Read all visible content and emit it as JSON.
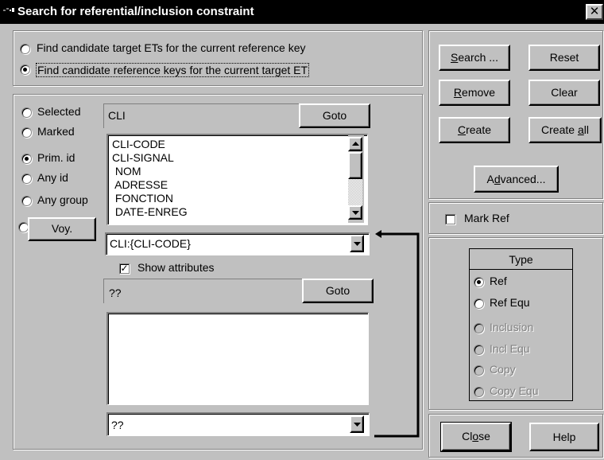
{
  "window": {
    "title": "Search for referential/inclusion constraint",
    "close_label": "✕"
  },
  "mode": {
    "options": [
      {
        "label": "Find candidate target ETs for the current reference key",
        "selected": false
      },
      {
        "label": "Find candidate reference keys for the current target ET",
        "selected": true
      }
    ]
  },
  "scope": {
    "options": [
      {
        "label": "Selected",
        "selected": false
      },
      {
        "label": "Marked",
        "selected": false
      },
      {
        "label": "Prim. id",
        "selected": true
      },
      {
        "label": "Any id",
        "selected": false
      },
      {
        "label": "Any group",
        "selected": false
      }
    ],
    "voy_label": "Voy."
  },
  "upper": {
    "field_value": "CLI",
    "goto_label": "Goto",
    "list_items": [
      "CLI-CODE",
      "CLI-SIGNAL",
      " NOM",
      " ADRESSE",
      " FONCTION",
      " DATE-ENREG"
    ],
    "combo_value": "CLI:{CLI-CODE}",
    "show_attributes_label": "Show attributes",
    "show_attributes_checked": true
  },
  "lower": {
    "field_value": "??",
    "goto_label": "Goto",
    "list_items": [],
    "combo_value": "??"
  },
  "buttons": {
    "search": {
      "pre": "",
      "key": "S",
      "post": "earch ..."
    },
    "reset": "Reset",
    "remove": {
      "pre": "",
      "key": "R",
      "post": "emove"
    },
    "clear": "Clear",
    "create": {
      "pre": "",
      "key": "C",
      "post": "reate"
    },
    "create_all": {
      "pre": "Create ",
      "key": "a",
      "post": "ll"
    },
    "advanced": {
      "pre": "A",
      "key": "d",
      "post": "vanced..."
    },
    "close": {
      "pre": "Cl",
      "key": "o",
      "post": "se"
    },
    "help": "Help"
  },
  "mark_ref": {
    "label": "Mark Ref",
    "checked": false
  },
  "type": {
    "title": "Type",
    "options": [
      {
        "label": "Ref",
        "selected": true,
        "enabled": true
      },
      {
        "label": "Ref Equ",
        "selected": false,
        "enabled": true
      },
      {
        "label": "Inclusion",
        "selected": false,
        "enabled": false
      },
      {
        "label": "Incl Equ",
        "selected": false,
        "enabled": false
      },
      {
        "label": "Copy",
        "selected": false,
        "enabled": false
      },
      {
        "label": "Copy Equ",
        "selected": false,
        "enabled": false
      }
    ]
  }
}
